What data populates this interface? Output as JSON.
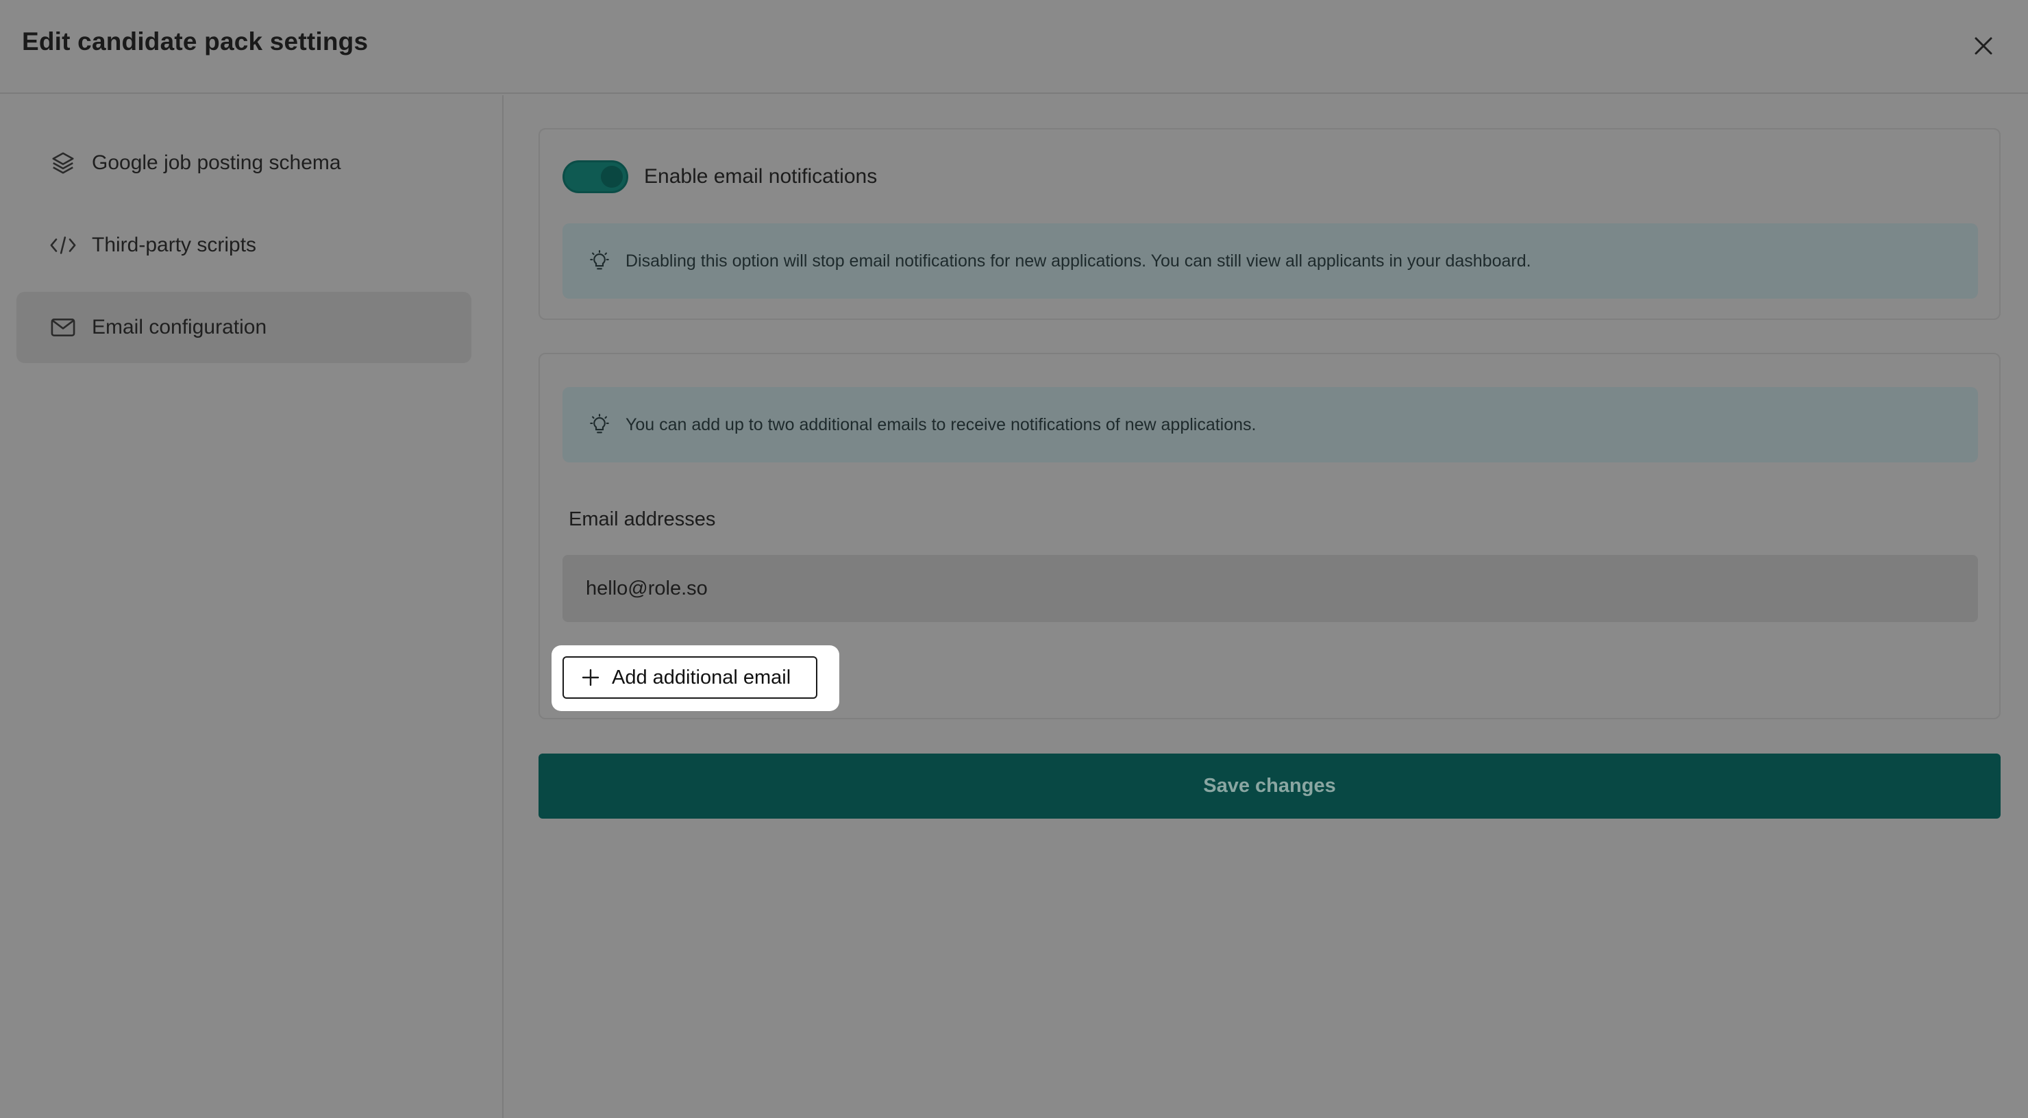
{
  "header": {
    "title": "Edit candidate pack settings",
    "close_icon": "close-icon"
  },
  "sidebar": {
    "items": [
      {
        "label": "Google job posting schema",
        "icon": "layers-icon",
        "active": false
      },
      {
        "label": "Third-party scripts",
        "icon": "code-icon",
        "active": false
      },
      {
        "label": "Email configuration",
        "icon": "mail-icon",
        "active": true
      }
    ]
  },
  "notifications": {
    "toggle_label": "Enable email notifications",
    "enabled": true,
    "info": "Disabling this option will stop email notifications for new applications. You can still view all applicants in your dashboard."
  },
  "emails": {
    "info": "You can add up to two additional emails to receive notifications of new applications.",
    "field_label": "Email addresses",
    "value": "hello@role.so",
    "add_label": "Add additional email"
  },
  "actions": {
    "save_label": "Save changes"
  },
  "colors": {
    "accent": "#084844",
    "overlay": "#8a8a8a"
  }
}
